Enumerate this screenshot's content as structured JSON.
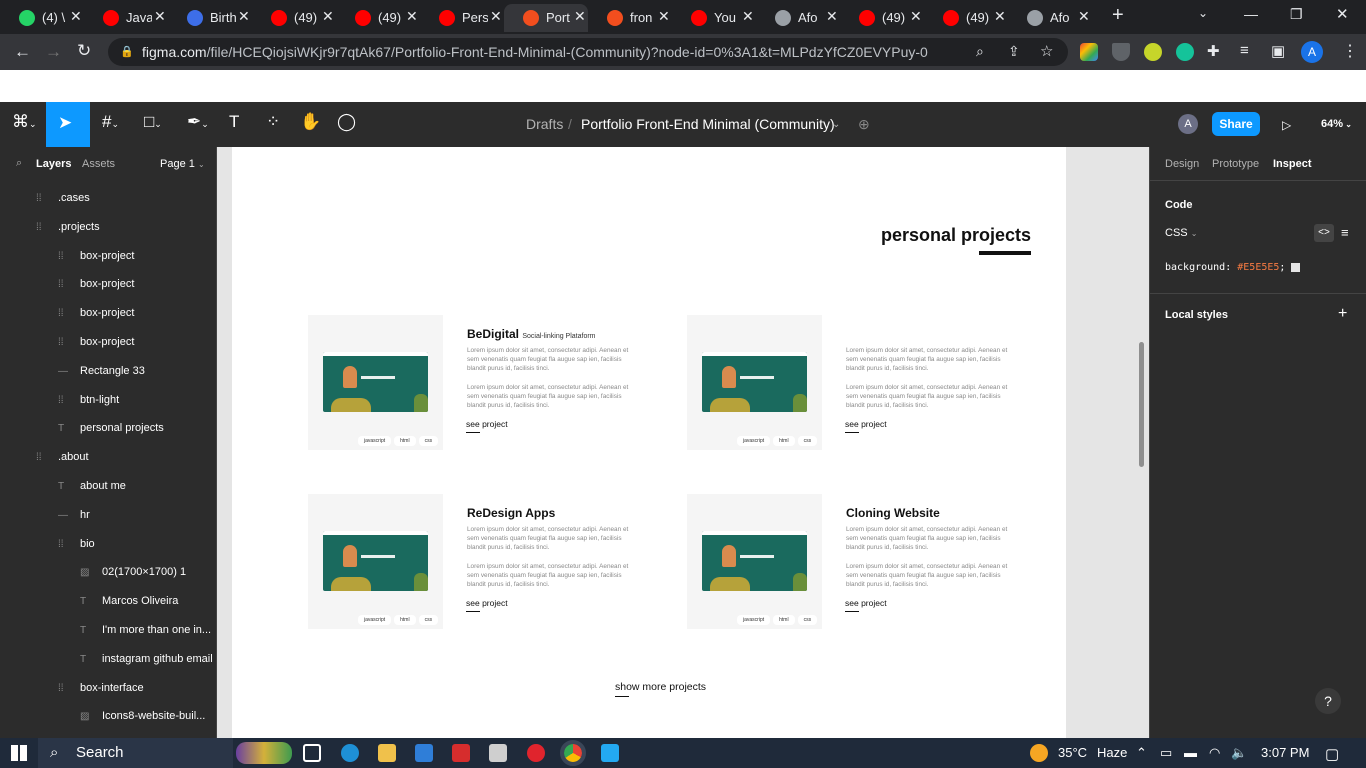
{
  "browser": {
    "tabs": [
      {
        "label": "(4) \\",
        "color": "#25d366"
      },
      {
        "label": "Java",
        "color": "#ff0000"
      },
      {
        "label": "Birth",
        "color": "#3d6ee8"
      },
      {
        "label": "(49)",
        "color": "#ff0000"
      },
      {
        "label": "(49)",
        "color": "#ff0000"
      },
      {
        "label": "Pers",
        "color": "#ff0000"
      },
      {
        "label": "Port",
        "color": "#f24e1e"
      },
      {
        "label": "fron",
        "color": "#f24e1e"
      },
      {
        "label": "You",
        "color": "#ff0000"
      },
      {
        "label": "Afo",
        "color": "#9aa0a6"
      },
      {
        "label": "(49)",
        "color": "#ff0000"
      },
      {
        "label": "(49)",
        "color": "#ff0000"
      },
      {
        "label": "Afo",
        "color": "#9aa0a6"
      }
    ],
    "new_tab": "+",
    "url_host": "figma.com",
    "url_path": "/file/HCEQiojsiWKjr9r7qtAk67/Portfolio-Front-End-Minimal-(Community)?node-id=0%3A1&t=MLPdzYfCZ0EVYPuy-0",
    "profile_initial": "A"
  },
  "figma": {
    "breadcrumb_root": "Drafts",
    "breadcrumb_sep": "/",
    "file_name": "Portfolio Front-End Minimal (Community)",
    "user_initial": "A",
    "share_label": "Share",
    "zoom": "64%"
  },
  "left_panel": {
    "tab_layers": "Layers",
    "tab_assets": "Assets",
    "page": "Page 1",
    "layers": [
      {
        "name": ".cases",
        "indent": 0,
        "icon": "frame-icon"
      },
      {
        "name": ".projects",
        "indent": 0,
        "icon": "frame-icon"
      },
      {
        "name": "box-project",
        "indent": 1,
        "icon": "frame-icon"
      },
      {
        "name": "box-project",
        "indent": 1,
        "icon": "frame-icon"
      },
      {
        "name": "box-project",
        "indent": 1,
        "icon": "frame-icon"
      },
      {
        "name": "box-project",
        "indent": 1,
        "icon": "frame-icon"
      },
      {
        "name": "Rectangle 33",
        "indent": 1,
        "icon": "line-icon"
      },
      {
        "name": "btn-light",
        "indent": 1,
        "icon": "frame-icon"
      },
      {
        "name": "personal projects",
        "indent": 1,
        "icon": "text-icon"
      },
      {
        "name": ".about",
        "indent": 0,
        "icon": "frame-icon"
      },
      {
        "name": "about me",
        "indent": 1,
        "icon": "text-icon"
      },
      {
        "name": "hr",
        "indent": 1,
        "icon": "line-icon"
      },
      {
        "name": "bio",
        "indent": 1,
        "icon": "frame-icon"
      },
      {
        "name": "02(1700×1700) 1",
        "indent": 2,
        "icon": "image-icon"
      },
      {
        "name": "Marcos Oliveira",
        "indent": 2,
        "icon": "text-icon"
      },
      {
        "name": "I'm more than one in...",
        "indent": 2,
        "icon": "text-icon"
      },
      {
        "name": "instagram github email",
        "indent": 2,
        "icon": "text-icon"
      },
      {
        "name": "box-interface",
        "indent": 1,
        "icon": "frame-icon"
      },
      {
        "name": "Icons8-website-buil...",
        "indent": 2,
        "icon": "image-icon"
      }
    ]
  },
  "canvas": {
    "section_title": "personal projects",
    "projects": [
      {
        "title": "BeDigital",
        "subtitle": "Social-linking Plataform"
      },
      {
        "title": "",
        "subtitle": ""
      },
      {
        "title": "ReDesign Apps",
        "subtitle": ""
      },
      {
        "title": "Cloning Website",
        "subtitle": ""
      }
    ],
    "lorem_1": "Lorem ipsum dolor sit amet, consectetur adipi. Aenean et sem venenatis quam feugiat fla augue sap ien, facilisis blandit purus id, facilisis tinci.",
    "lorem_2": "Lorem ipsum dolor sit amet, consectetur adipi. Aenean et sem venenatis quam feugiat fla augue sap ien, facilisis blandit purus id, facilisis tinci.",
    "see_project": "see project",
    "tags": [
      "javascript",
      "html",
      "css"
    ],
    "show_more": "show more projects",
    "canvas_bg": "#E5E5E5"
  },
  "right_panel": {
    "tab_design": "Design",
    "tab_prototype": "Prototype",
    "tab_inspect": "Inspect",
    "code_heading": "Code",
    "language": "CSS",
    "css_property": "background:",
    "css_value": "#E5E5E5",
    "css_end": ";",
    "local_styles": "Local styles",
    "help": "?"
  },
  "taskbar": {
    "search": "Search",
    "temperature": "35°C",
    "weather": "Haze",
    "time": "3:07 PM"
  }
}
